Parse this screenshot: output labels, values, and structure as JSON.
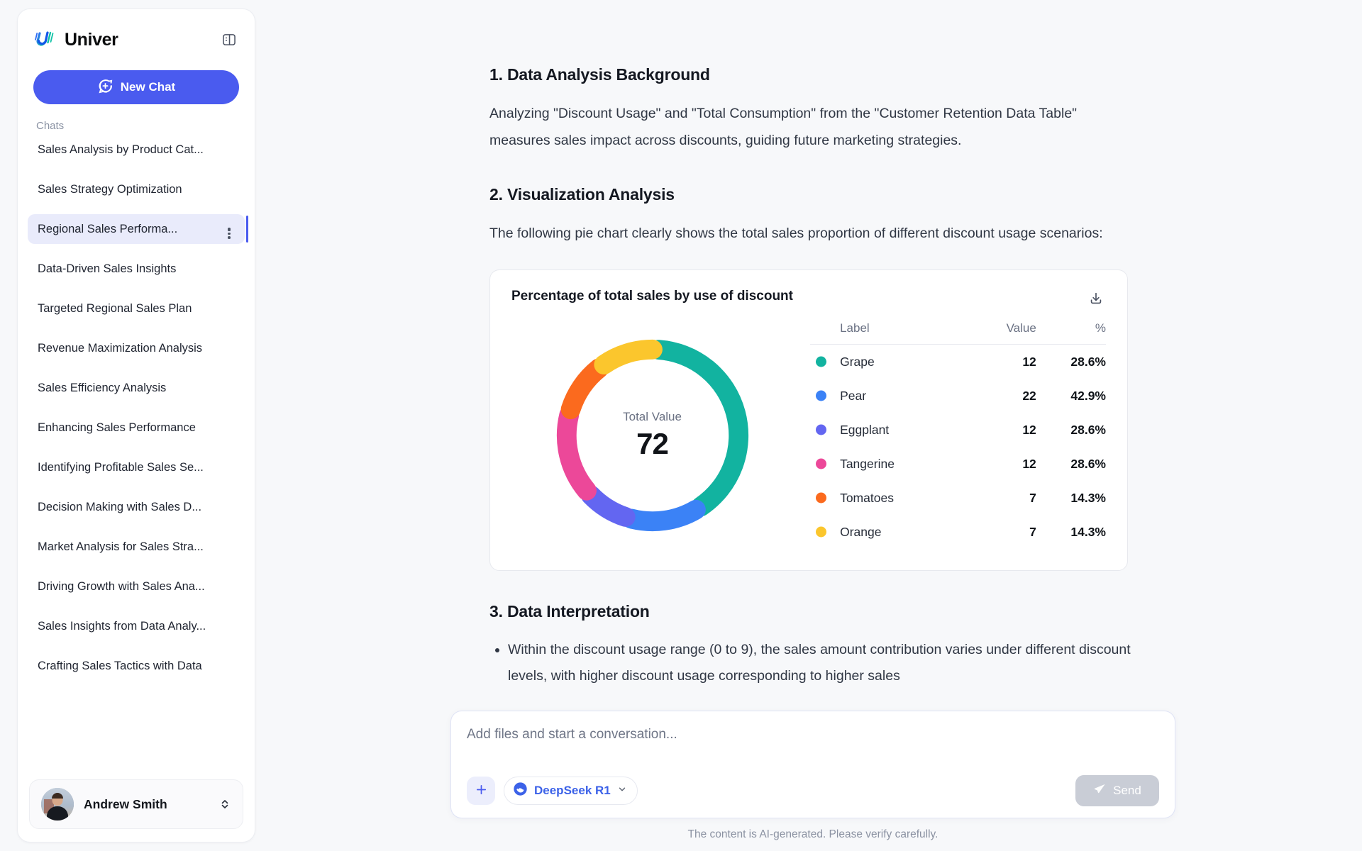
{
  "brand": {
    "name": "Univer",
    "logo_icon": "univer-logo-icon",
    "panel_toggle_icon": "panel-toggle-icon"
  },
  "sidebar": {
    "new_chat_label": "New Chat",
    "new_chat_icon": "plus-circle-chat-icon",
    "chats_heading": "Chats",
    "chats": [
      {
        "label": "Sales Analysis by Product Cat...",
        "active": false
      },
      {
        "label": "Sales Strategy Optimization",
        "active": false
      },
      {
        "label": "Regional Sales Performa...",
        "active": true
      },
      {
        "label": "Data-Driven Sales Insights",
        "active": false
      },
      {
        "label": "Targeted Regional Sales Plan",
        "active": false
      },
      {
        "label": "Revenue Maximization Analysis",
        "active": false
      },
      {
        "label": "Sales Efficiency Analysis",
        "active": false
      },
      {
        "label": "Enhancing Sales Performance",
        "active": false
      },
      {
        "label": "Identifying Profitable Sales Se...",
        "active": false
      },
      {
        "label": "Decision Making with Sales D...",
        "active": false
      },
      {
        "label": "Market Analysis for Sales Stra...",
        "active": false
      },
      {
        "label": "Driving Growth with Sales Ana...",
        "active": false
      },
      {
        "label": "Sales Insights from Data Analy...",
        "active": false
      },
      {
        "label": "Crafting Sales Tactics with Data",
        "active": false
      }
    ],
    "user": {
      "name": "Andrew Smith",
      "avatar_icon": "user-avatar",
      "switch_icon": "chevron-up-down-icon"
    }
  },
  "main": {
    "sections": [
      {
        "heading": "1. Data Analysis Background",
        "paragraph": "Analyzing \"Discount Usage\" and \"Total Consumption\" from the \"Customer Retention Data Table\" measures sales impact across discounts, guiding future marketing strategies."
      },
      {
        "heading": "2. Visualization Analysis",
        "paragraph": "The following pie chart clearly shows the total sales proportion of different discount usage scenarios:"
      },
      {
        "heading": "3. Data Interpretation",
        "bullet": "Within the discount usage range (0 to 9), the sales amount contribution varies under different discount levels, with higher discount usage corresponding to higher sales"
      }
    ],
    "chart_card": {
      "title": "Percentage of total sales by use of discount",
      "download_icon": "download-icon"
    }
  },
  "chart_data": {
    "type": "pie",
    "variant": "donut",
    "title": "Percentage of total sales by use of discount",
    "center_label": "Total Value",
    "center_value": "72",
    "total": 72,
    "legend_position": "right",
    "columns": [
      "Label",
      "Value",
      "%"
    ],
    "categories": [
      "Grape",
      "Pear",
      "Eggplant",
      "Tangerine",
      "Tomatoes",
      "Orange"
    ],
    "values": [
      12,
      22,
      12,
      12,
      7,
      7
    ],
    "percents": [
      "28.6%",
      "42.9%",
      "28.6%",
      "28.6%",
      "14.3%",
      "14.3%"
    ],
    "arc_fractions": [
      0.405,
      0.135,
      0.088,
      0.16,
      0.105,
      0.107
    ],
    "colors": [
      "#12b3a0",
      "#3b82f6",
      "#6366f1",
      "#ec4899",
      "#fb6a1e",
      "#fbc62d"
    ],
    "rows": [
      {
        "label": "Grape",
        "value": "12",
        "pct": "28.6%",
        "color": "#12b3a0"
      },
      {
        "label": "Pear",
        "value": "22",
        "pct": "42.9%",
        "color": "#3b82f6"
      },
      {
        "label": "Eggplant",
        "value": "12",
        "pct": "28.6%",
        "color": "#6366f1"
      },
      {
        "label": "Tangerine",
        "value": "12",
        "pct": "28.6%",
        "color": "#ec4899"
      },
      {
        "label": "Tomatoes",
        "value": "7",
        "pct": "14.3%",
        "color": "#fb6a1e"
      },
      {
        "label": "Orange",
        "value": "7",
        "pct": "14.3%",
        "color": "#fbc62d"
      }
    ]
  },
  "composer": {
    "placeholder": "Add files and start a conversation...",
    "value": "",
    "attach_icon": "plus-icon",
    "model_icon": "deepseek-whale-icon",
    "model_name": "DeepSeek R1",
    "model_caret_icon": "chevron-down-icon",
    "send_label": "Send",
    "send_icon": "send-paper-plane-icon",
    "disclaimer": "The content is AI-generated. Please verify carefully."
  }
}
